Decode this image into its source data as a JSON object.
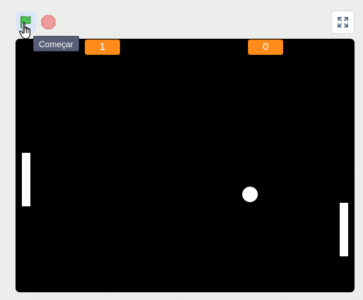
{
  "controls": {
    "start_tooltip": "Começar",
    "green_flag_icon": "green-flag-icon",
    "stop_icon": "stop-sign-icon",
    "fullscreen_icon": "fullscreen-icon"
  },
  "scores": {
    "left": "1",
    "right": "0"
  },
  "colors": {
    "flag_green": "#4cbf56",
    "stop_red": "#ec9c9c",
    "score_orange": "#ff8c1a",
    "stage_bg": "#000000",
    "sprites": "#ffffff"
  }
}
